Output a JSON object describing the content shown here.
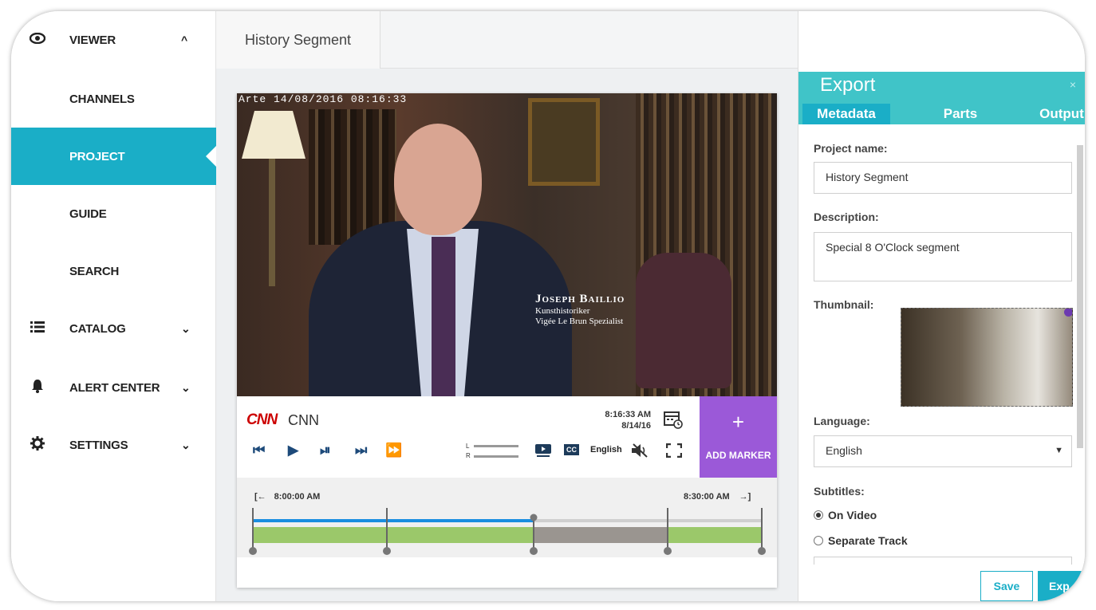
{
  "sidebar": {
    "items": [
      {
        "label": "VIEWER",
        "icon": "eye-icon",
        "chevron": "^"
      },
      {
        "label": "CHANNELS"
      },
      {
        "label": "PROJECT"
      },
      {
        "label": "GUIDE"
      },
      {
        "label": "SEARCH"
      },
      {
        "label": "CATALOG",
        "icon": "list-icon",
        "chevron": "⌄"
      },
      {
        "label": "ALERT CENTER",
        "icon": "bell-icon",
        "chevron": "⌄"
      },
      {
        "label": "SETTINGS",
        "icon": "gear-icon",
        "chevron": "⌄"
      }
    ]
  },
  "main": {
    "tab_title": "History Segment"
  },
  "video": {
    "osd": "Arte 14/08/2016 08:16:33",
    "caption_name": "Joseph Baillio",
    "caption_line1": "Kunsthistoriker",
    "caption_line2": "Vigée Le Brun Spezialist"
  },
  "player": {
    "channel_logo": "CNN",
    "channel_name": "CNN",
    "time": "8:16:33 AM",
    "date": "8/14/16",
    "level_l": "L",
    "level_r": "R",
    "cc_label": "CC",
    "language": "English",
    "add_marker_plus": "+",
    "add_marker_label": "ADD MARKER"
  },
  "timeline": {
    "start_time": "8:00:00 AM",
    "end_time": "8:30:00 AM"
  },
  "export": {
    "title": "Export",
    "close": "×",
    "tabs": [
      "Metadata",
      "Parts",
      "Output"
    ],
    "project_name_label": "Project name:",
    "project_name_value": "History Segment",
    "description_label": "Description:",
    "description_value": "Special 8 O'Clock segment",
    "thumbnail_label": "Thumbnail:",
    "language_label": "Language:",
    "language_value": "English",
    "subtitles_label": "Subtitles:",
    "subtitles_options": [
      "On Video",
      "Separate Track"
    ],
    "save_label": "Save",
    "export_label": "Exp"
  },
  "colors": {
    "accent": "#1aaec7",
    "export_header": "#40c4c8",
    "add_marker": "#9b59d8",
    "timeline_green": "#9bc86a",
    "timeline_blue": "#1a8ee0"
  }
}
